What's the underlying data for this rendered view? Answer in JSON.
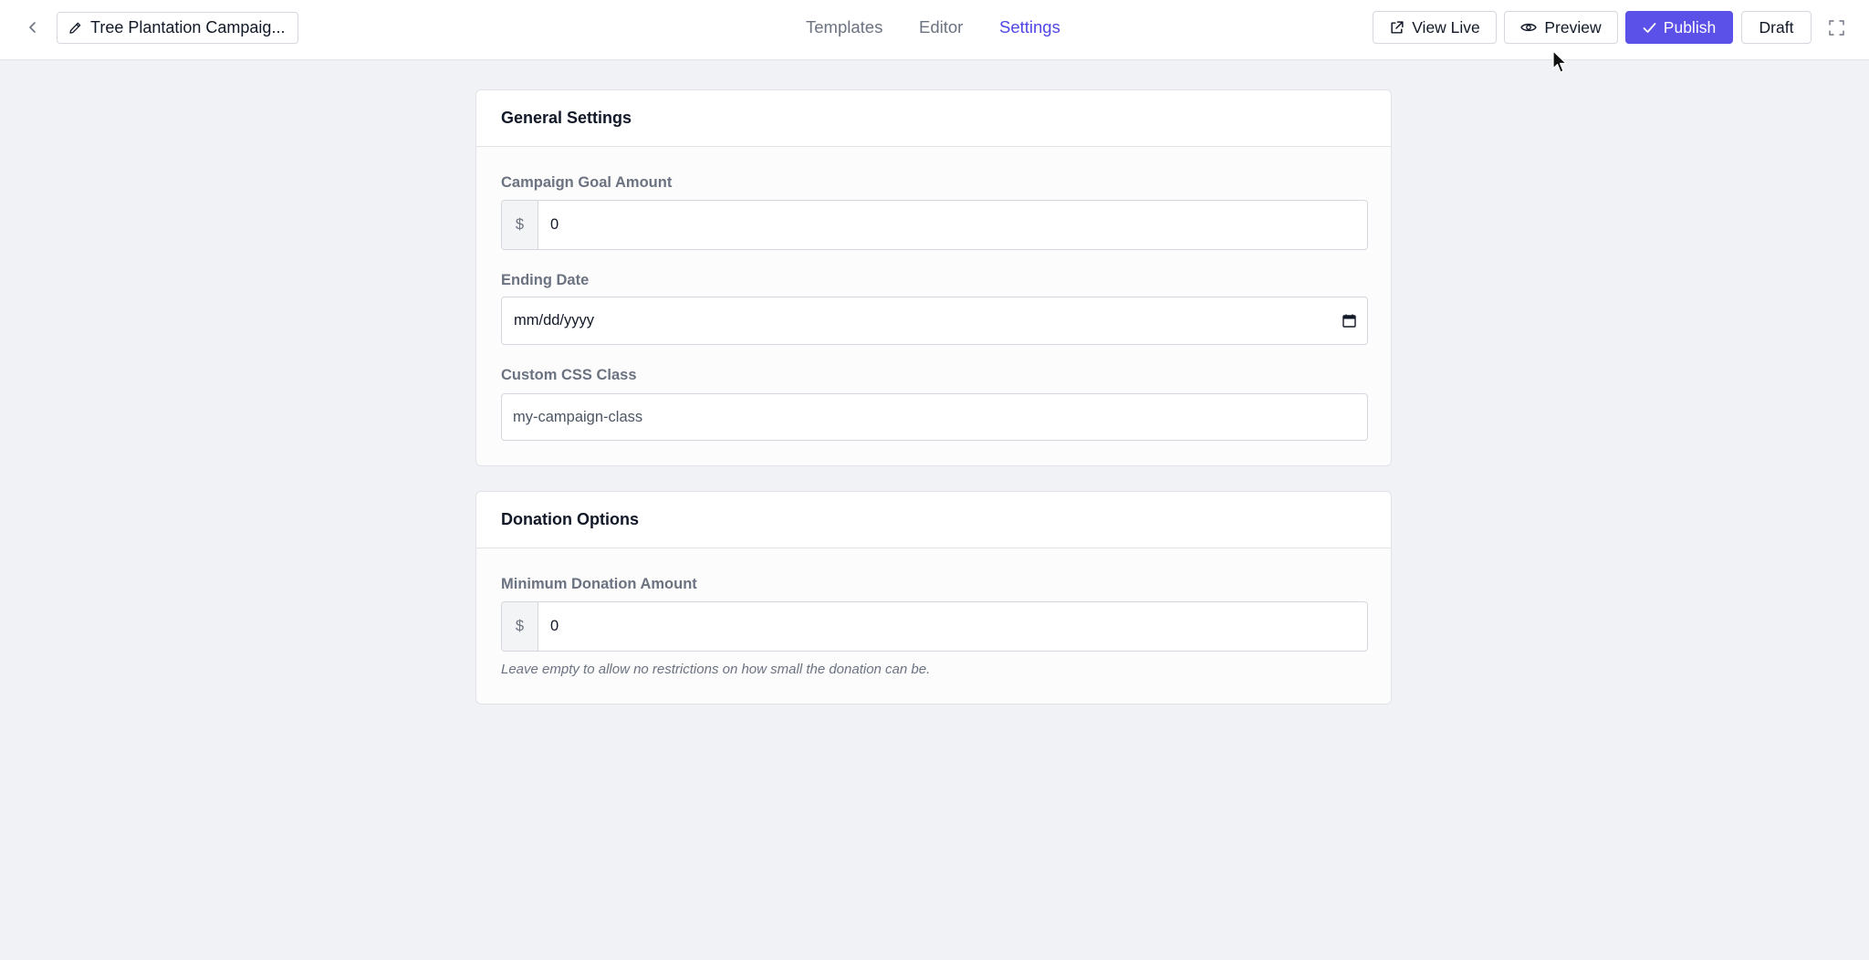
{
  "header": {
    "campaign_title": "Tree Plantation Campaig...",
    "tabs": [
      {
        "label": "Templates",
        "active": false
      },
      {
        "label": "Editor",
        "active": false
      },
      {
        "label": "Settings",
        "active": true
      }
    ],
    "actions": {
      "view_live": "View Live",
      "preview": "Preview",
      "publish": "Publish",
      "draft": "Draft"
    },
    "icons": {
      "back": "chevron-left-icon",
      "edit": "pencil-icon",
      "view_live": "external-link-icon",
      "preview": "eye-icon",
      "publish": "check-icon",
      "fullscreen": "expand-icon"
    }
  },
  "general_settings": {
    "title": "General Settings",
    "goal": {
      "label": "Campaign Goal Amount",
      "prefix": "$",
      "value": "0"
    },
    "ending_date": {
      "label": "Ending Date",
      "value": "mm/dd/yyyy",
      "icon": "calendar-icon"
    },
    "css_class": {
      "label": "Custom CSS Class",
      "value": "my-campaign-class"
    }
  },
  "donation_options": {
    "title": "Donation Options",
    "minimum": {
      "label": "Minimum Donation Amount",
      "prefix": "$",
      "value": "0"
    },
    "help": "Leave empty to allow no restrictions on how small the donation can be."
  },
  "colors": {
    "accent": "#4f46e5",
    "publish_bg": "#5b50e8",
    "background": "#f1f2f6"
  }
}
